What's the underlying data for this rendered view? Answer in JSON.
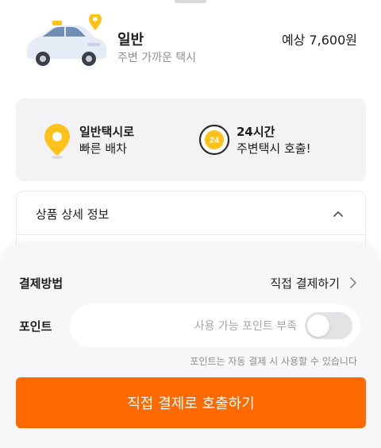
{
  "vehicle": {
    "name": "일반",
    "subtitle": "주변 가까운 택시",
    "price": "예상 7,600원",
    "icon": "taxi-car-icon"
  },
  "features": [
    {
      "icon": "location-pin-icon",
      "line1": "일반택시로",
      "line2": "빠른 배차"
    },
    {
      "icon": "clock-24-icon",
      "line1": "24시간",
      "line2": "주변택시 호출!",
      "badge": "24"
    }
  ],
  "detail": {
    "title": "상품 상세 정보",
    "expanded": true
  },
  "payment": {
    "label": "결제방법",
    "value": "직접 결제하기"
  },
  "points": {
    "label": "포인트",
    "placeholder": "사용 가능 포인트 부족",
    "toggle_on": false,
    "note": "포인트는 자동 결제 시 사용할 수 있습니다"
  },
  "call_button": {
    "label": "직접 결제로 호출하기"
  },
  "colors": {
    "accent": "#ff6a00",
    "yellow": "#ffc21a",
    "background": "#f5f5f7"
  }
}
